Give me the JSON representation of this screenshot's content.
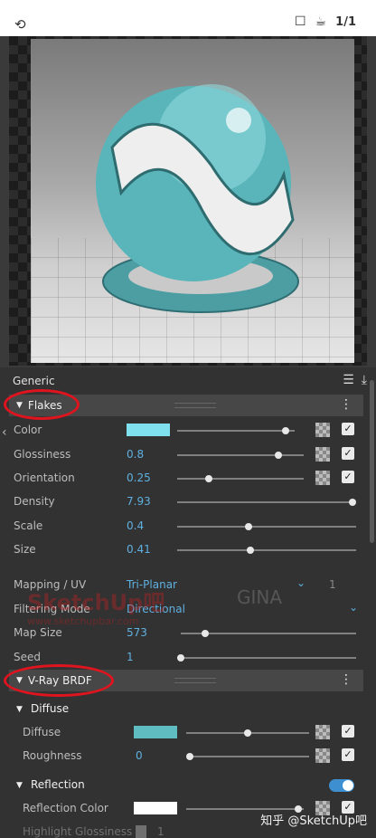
{
  "toolbar": {
    "ratio": "1/1"
  },
  "panel": {
    "title": "Generic"
  },
  "flakes": {
    "title": "Flakes",
    "color_label": "Color",
    "color_value": "#7fe0ee",
    "glossiness_label": "Glossiness",
    "glossiness_value": "0.8",
    "orientation_label": "Orientation",
    "orientation_value": "0.25",
    "density_label": "Density",
    "density_value": "7.93",
    "scale_label": "Scale",
    "scale_value": "0.4",
    "size_label": "Size",
    "size_value": "0.41",
    "mapping_label": "Mapping / UV",
    "mapping_value": "Tri-Planar",
    "mapping_channel": "1",
    "filtering_label": "Filtering Mode",
    "filtering_value": "Directional",
    "mapsize_label": "Map Size",
    "mapsize_value": "573",
    "seed_label": "Seed",
    "seed_value": "1",
    "sliders": {
      "color": 0.92,
      "glossiness": 0.8,
      "orientation": 0.25,
      "density": 1.0,
      "scale": 0.4,
      "size": 0.41,
      "mapsize": 0.14,
      "seed": 0.0
    }
  },
  "brdf": {
    "title": "V-Ray BRDF",
    "diffuse_title": "Diffuse",
    "diffuse_label": "Diffuse",
    "diffuse_color": "#5fbcc0",
    "roughness_label": "Roughness",
    "roughness_value": "0",
    "reflection_title": "Reflection",
    "reflection_color_label": "Reflection Color",
    "reflection_color": "#ffffff",
    "highlight_label": "Highlight Glossiness",
    "highlight_value": "1",
    "sliders": {
      "diffuse": 0.5,
      "roughness": 0.0,
      "reflection_color": 0.95
    }
  },
  "watermark": {
    "brand": "SketchUp吧",
    "url": "www.sketchupbar.com",
    "studio": "GINA"
  },
  "footer": {
    "credit": "知乎 @SketchUp吧"
  },
  "colors": {
    "accent": "#5fb0e0",
    "highlight_circle": "#e0141e",
    "toggle_on": "#3d8fd0"
  }
}
